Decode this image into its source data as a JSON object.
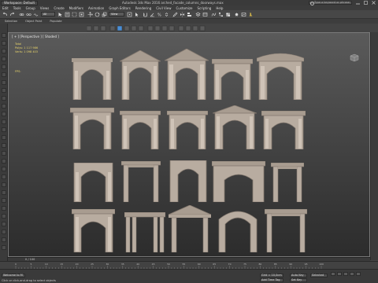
{
  "titlebar": {
    "workspace_label": "Workspace: Default",
    "app_title": "Autodesk 3ds Max 2016    arched_facade_columns_doorways.max",
    "search_placeholder": "Type a keyword or phrase"
  },
  "menubar": {
    "items": [
      "Edit",
      "Tools",
      "Group",
      "Views",
      "Create",
      "Modifiers",
      "Animation",
      "Graph Editors",
      "Rendering",
      "Civil View",
      "Customize",
      "Scripting",
      "Help"
    ]
  },
  "toolbar": {
    "selection_filter": "All",
    "view_dropdown": "View"
  },
  "ribbon_tabs": [
    "Selection",
    "Object Paint",
    "Populate"
  ],
  "viewport": {
    "label": "[ + ] [Perspective ] [ Shaded ]",
    "stats_total_label": "Total",
    "stats_polys": "Polys:   1 117 986",
    "stats_verts": "Verts:   1 098 403",
    "fps_label": "FPS:"
  },
  "timeline": {
    "frame_counter": "0 / 100"
  },
  "trackbar": {
    "tick_labels": [
      "0",
      "5",
      "10",
      "15",
      "20",
      "25",
      "30",
      "35",
      "40",
      "45",
      "50",
      "55",
      "60",
      "65",
      "70",
      "75",
      "80",
      "85",
      "90",
      "95",
      "100"
    ]
  },
  "statusbar": {
    "prompt": "Click or click-and-drag to select objects",
    "welcome": "Welcome to M",
    "grid_field": "Grid = 10,0cm",
    "add_time_tag": "Add Time Tag",
    "auto_key": "Auto Key",
    "set_key": "Set Key",
    "selected": "Selected"
  },
  "colors": {
    "arch_fill": "#b8aca0",
    "arch_shadow": "#857a70",
    "viewport_top": "#5a5a5a",
    "viewport_bottom": "#2c2c2c",
    "stats_text": "#e8d46a",
    "accent_blue": "#4a8fd6"
  }
}
